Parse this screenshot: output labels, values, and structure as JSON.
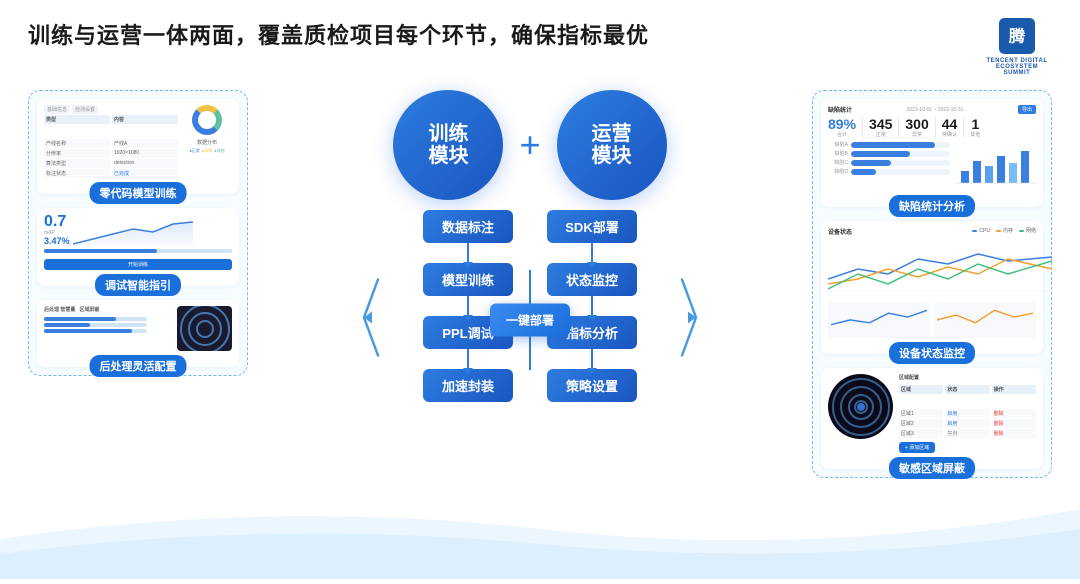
{
  "header": {
    "title": "训练与运营一体两面，覆盖质检项目每个环节，确保指标最优",
    "logo_text": "TENCENT DIGITAL ECOSYSTEM SUMMIT"
  },
  "left_panel": {
    "cards": [
      {
        "label": "零代码模型训练",
        "type": "training_card"
      },
      {
        "label": "调试智能指引",
        "value": "0.7",
        "value2": "3.47%",
        "type": "debug_card"
      },
      {
        "label": "后处理灵活配置",
        "type": "postprocess_card"
      }
    ]
  },
  "center_panel": {
    "train_bubble": {
      "line1": "训练",
      "line2": "模块"
    },
    "plus": "+",
    "operation_bubble": {
      "line1": "运营",
      "line2": "模块"
    },
    "left_flow": [
      {
        "label": "数据标注"
      },
      {
        "label": "模型训练"
      },
      {
        "label": "PPL调试"
      },
      {
        "label": "加速封装"
      }
    ],
    "center_deploy": {
      "label": "一键部署"
    },
    "right_flow": [
      {
        "label": "SDK部署"
      },
      {
        "label": "状态监控"
      },
      {
        "label": "指标分析"
      },
      {
        "label": "策略设置"
      }
    ]
  },
  "right_panel": {
    "cards": [
      {
        "label": "缺陷统计分析",
        "type": "stats_card",
        "stats": [
          {
            "value": "89%",
            "name": "合计",
            "color": "blue"
          },
          {
            "value": "345",
            "name": "正常"
          },
          {
            "value": "300",
            "name": "异常"
          },
          {
            "value": "44",
            "name": "待确认"
          },
          {
            "value": "1",
            "name": "其他"
          }
        ]
      },
      {
        "label": "设备状态监控",
        "type": "line_chart_card",
        "legend": [
          "CPU",
          "内存",
          "网络"
        ]
      },
      {
        "label": "敏感区域屏蔽",
        "type": "camera_card"
      }
    ]
  }
}
